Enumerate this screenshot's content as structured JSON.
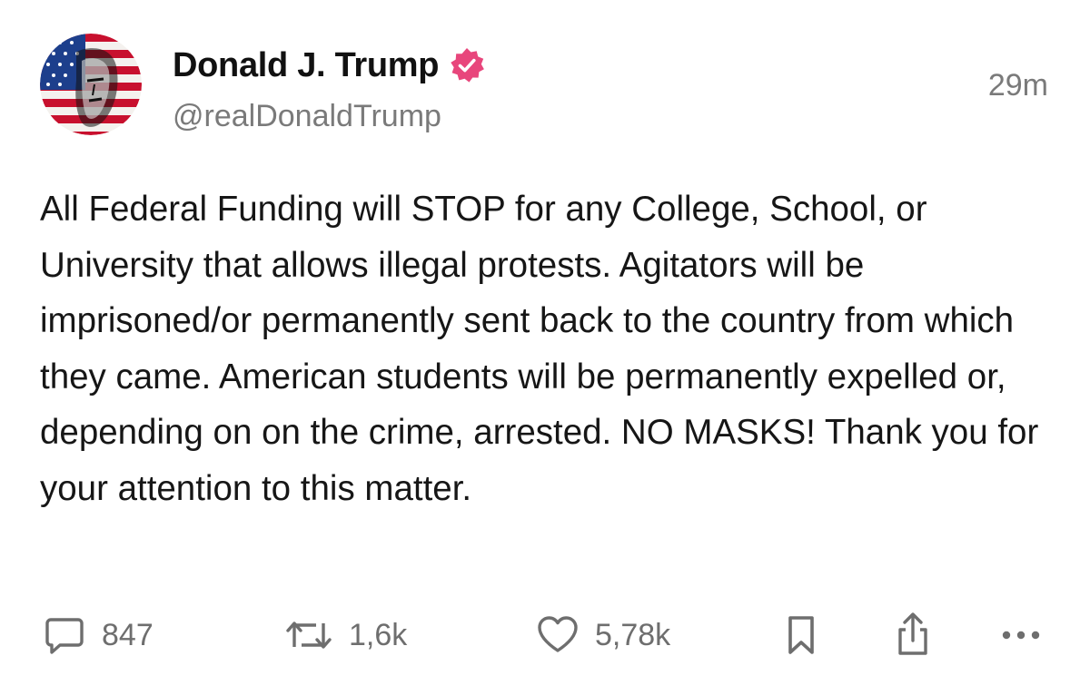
{
  "post": {
    "author": {
      "display_name": "Donald J. Trump",
      "handle": "@realDonaldTrump",
      "verified": true,
      "avatar_icon": "flag-portrait-avatar"
    },
    "timestamp": "29m",
    "text": "All Federal Funding will STOP for any College, School, or University that allows illegal protests. Agitators will be imprisoned/or permanently sent back to the country from which they came. American students will be permanently expelled or, depending on on the crime, arrested. NO MASKS! Thank you for your attention to this matter.",
    "actions": {
      "replies": {
        "icon": "reply-icon",
        "count": "847"
      },
      "reposts": {
        "icon": "repost-icon",
        "count": "1,6k"
      },
      "likes": {
        "icon": "heart-icon",
        "count": "5,78k"
      },
      "bookmark": {
        "icon": "bookmark-icon"
      },
      "share": {
        "icon": "share-icon"
      },
      "more": {
        "icon": "more-icon"
      }
    }
  },
  "colors": {
    "verified_badge": "#e8467c",
    "name_text": "#111111",
    "secondary_text": "#7a7a7a",
    "body_text": "#161616",
    "icon": "#6e6e6e"
  }
}
